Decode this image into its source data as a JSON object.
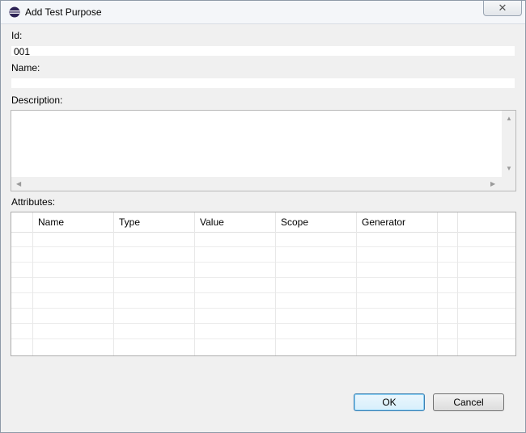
{
  "window": {
    "title": "Add Test Purpose",
    "close_glyph": "✕"
  },
  "form": {
    "id_label": "Id:",
    "id_value": "001",
    "name_label": "Name:",
    "name_value": "",
    "description_label": "Description:",
    "description_value": "",
    "attributes_label": "Attributes:"
  },
  "attributes_table": {
    "columns": [
      "",
      "Name",
      "Type",
      "Value",
      "Scope",
      "Generator",
      "",
      ""
    ],
    "rows": [
      [
        "",
        "",
        "",
        "",
        "",
        "",
        "",
        ""
      ],
      [
        "",
        "",
        "",
        "",
        "",
        "",
        "",
        ""
      ],
      [
        "",
        "",
        "",
        "",
        "",
        "",
        "",
        ""
      ],
      [
        "",
        "",
        "",
        "",
        "",
        "",
        "",
        ""
      ],
      [
        "",
        "",
        "",
        "",
        "",
        "",
        "",
        ""
      ],
      [
        "",
        "",
        "",
        "",
        "",
        "",
        "",
        ""
      ],
      [
        "",
        "",
        "",
        "",
        "",
        "",
        "",
        ""
      ],
      [
        "",
        "",
        "",
        "",
        "",
        "",
        "",
        ""
      ]
    ]
  },
  "buttons": {
    "ok_label": "OK",
    "cancel_label": "Cancel"
  },
  "icons": {
    "app": "eclipse-icon",
    "close": "close-icon",
    "scroll_up": "scroll-up-arrow-icon",
    "scroll_down": "scroll-down-arrow-icon",
    "scroll_left": "scroll-left-arrow-icon",
    "scroll_right": "scroll-right-arrow-icon"
  },
  "colors": {
    "dialog_background": "#f0f0f0",
    "default_button_border": "#3c7fb1"
  }
}
